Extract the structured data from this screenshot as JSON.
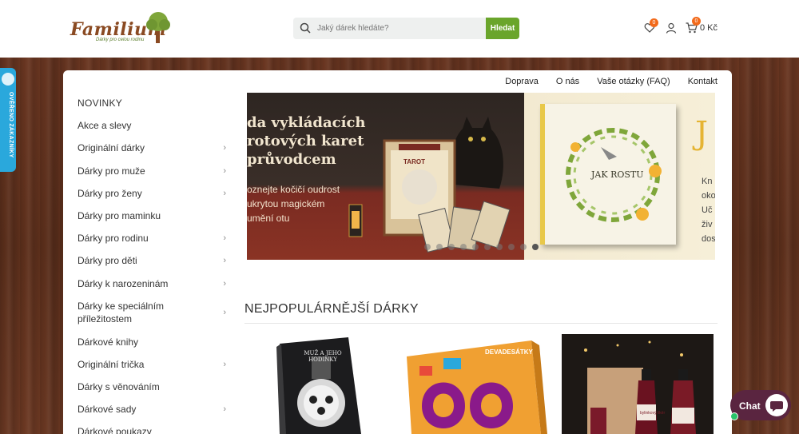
{
  "header": {
    "logo_text": "Familium",
    "logo_tagline": "Dárky pro celou rodinu",
    "search_placeholder": "Jaký dárek hledáte?",
    "search_button": "Hledat",
    "wishlist_count": "0",
    "cart_count": "0",
    "cart_total": "0 Kč"
  },
  "side_tab": {
    "label": "OVĚŘENO ZÁKAZNÍKY"
  },
  "top_nav": [
    "Doprava",
    "O nás",
    "Vaše otázky (FAQ)",
    "Kontakt"
  ],
  "menu": [
    {
      "label": "NOVINKY",
      "has_children": false
    },
    {
      "label": "Akce a slevy",
      "has_children": false
    },
    {
      "label": "Originální dárky",
      "has_children": true
    },
    {
      "label": "Dárky pro muže",
      "has_children": true
    },
    {
      "label": "Dárky pro ženy",
      "has_children": true
    },
    {
      "label": "Dárky pro maminku",
      "has_children": false
    },
    {
      "label": "Dárky pro rodinu",
      "has_children": true
    },
    {
      "label": "Dárky pro děti",
      "has_children": true
    },
    {
      "label": "Dárky k narozeninám",
      "has_children": true
    },
    {
      "label": "Dárky ke speciálním příležitostem",
      "has_children": true
    },
    {
      "label": "Dárkové knihy",
      "has_children": false
    },
    {
      "label": "Originální trička",
      "has_children": true
    },
    {
      "label": "Dárky s věnováním",
      "has_children": false
    },
    {
      "label": "Dárkové sady",
      "has_children": true
    },
    {
      "label": "Dárkové poukazy",
      "has_children": false
    }
  ],
  "banner": {
    "slide1_title": "da vykládacích rotových karet průvodcem",
    "slide1_subtitle": "oznejte kočičí oudrost ukrytou magickém umění otu",
    "slide1_book_label": "TAROT",
    "slide2_book_title": "JAK ROSTU",
    "slide2_big_letter": "J",
    "slide2_side_lines": [
      "Kn",
      "oko",
      "Uč",
      "živ",
      "dos"
    ],
    "dots_count": 10,
    "active_dot": 9
  },
  "section": {
    "title": "NEJPOPULÁRNĚJŠÍ DÁRKY"
  },
  "products": [
    {
      "title": "MUŽ A JEHO HODINKY"
    },
    {
      "title": "DEVADESÁTKY",
      "subtitle": "90"
    },
    {
      "title": "bylinkový likér"
    }
  ],
  "chat": {
    "label": "Chat"
  },
  "colors": {
    "accent_green": "#6aa52b",
    "badge_orange": "#f26a1b",
    "side_tab_blue": "#2aa8dc",
    "chat_purple": "#5a2540"
  }
}
